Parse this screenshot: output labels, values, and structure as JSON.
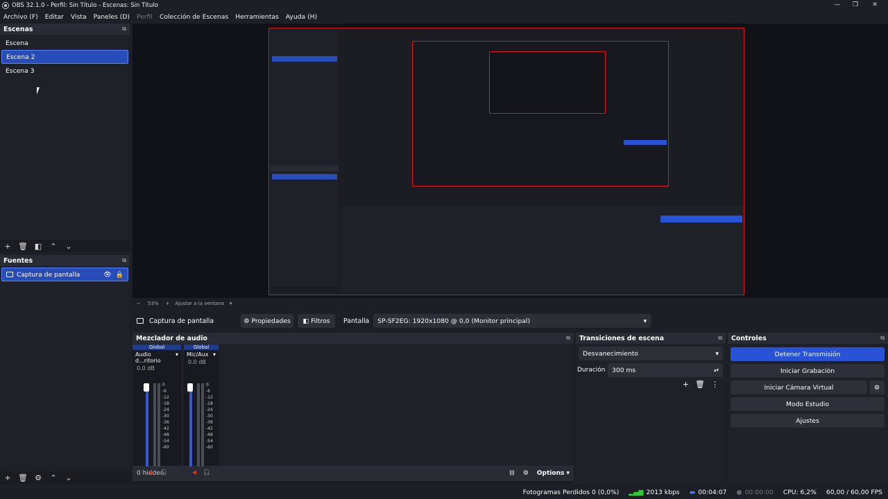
{
  "window": {
    "title": "OBS 32.1.0 - Perfil: Sin Título - Escenas: Sin Título"
  },
  "menu": [
    {
      "label": "Archivo (F)",
      "enabled": true
    },
    {
      "label": "Editar",
      "enabled": true
    },
    {
      "label": "Vista",
      "enabled": true
    },
    {
      "label": "Paneles (D)",
      "enabled": true
    },
    {
      "label": "Perfil",
      "enabled": false
    },
    {
      "label": "Colección de Escenas",
      "enabled": true
    },
    {
      "label": "Herramientas",
      "enabled": true
    },
    {
      "label": "Ayuda (H)",
      "enabled": true
    }
  ],
  "scenes": {
    "title": "Escenas",
    "items": [
      "Escena",
      "Escena 2",
      "Escena 3"
    ],
    "selected_index": 1
  },
  "sources": {
    "title": "Fuentes",
    "items": [
      {
        "label": "Captura de pantalla"
      }
    ]
  },
  "preview": {
    "zoom": "53%",
    "fit_label": "Ajustar a la ventana"
  },
  "source_bar": {
    "source_name": "Captura de pantalla",
    "properties_label": "Propiedades",
    "filters_label": "Filtros",
    "display_label": "Pantalla",
    "display_value": "SP-SF2EG: 1920x1080 @ 0,0 (Monitor principal)"
  },
  "mixer": {
    "title": "Mezclador de audio",
    "channels": [
      {
        "badge": "Global",
        "name": "Audio d...ritorio",
        "db": "0.0 dB"
      },
      {
        "badge": "Global",
        "name": "Mic/Aux",
        "db": "0.0 dB"
      }
    ],
    "scale": [
      "0",
      "-6",
      "-12",
      "-18",
      "-24",
      "-30",
      "-36",
      "-42",
      "-48",
      "-54",
      "-60"
    ],
    "hidden_label": "0 hidden",
    "options_label": "Options"
  },
  "transitions": {
    "title": "Transiciones de escena",
    "selected": "Desvanecimiento",
    "duration_label": "Duración",
    "duration_value": "300 ms"
  },
  "controls": {
    "title": "Controles",
    "buttons": [
      "Detener Transmisión",
      "Iniciar Grabación",
      "Iniciar Cámara Virtual",
      "Modo Estudio",
      "Ajustes"
    ]
  },
  "status": {
    "dropped_frames": "Fotogramas Perdidos 0 (0,0%)",
    "bitrate": "2013 kbps",
    "stream_time": "00:04:07",
    "record_time": "00:00:00",
    "cpu": "CPU: 6,2%",
    "fps": "60,00 / 60,00 FPS"
  },
  "colors": {
    "accent": "#2a52d6",
    "selection": "#284cb8",
    "bg": "#1d1f26",
    "preview_border": "#e0141e"
  }
}
